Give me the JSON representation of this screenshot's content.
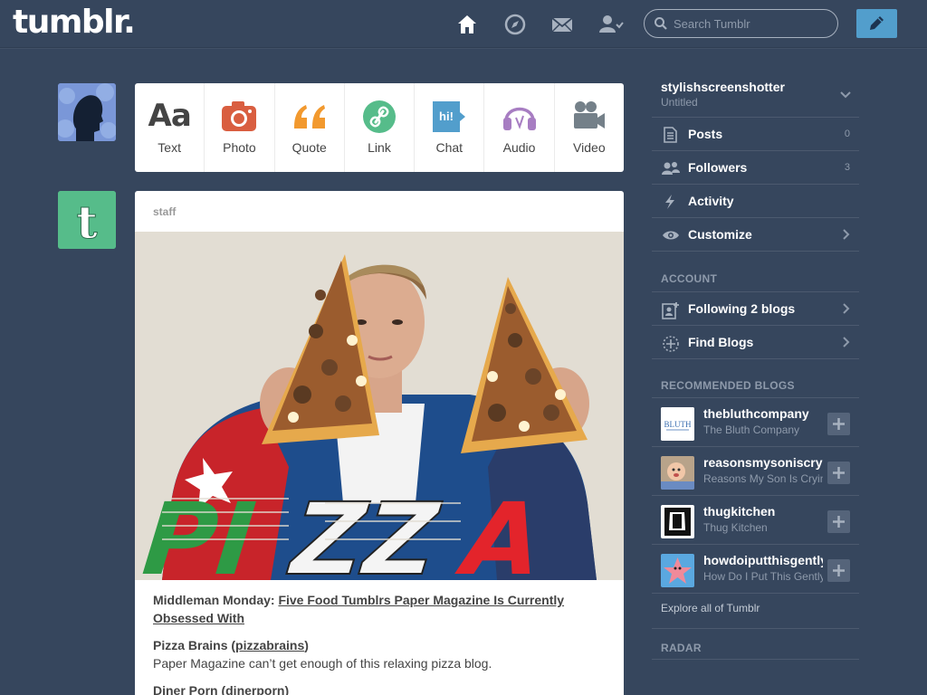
{
  "header": {
    "logo": "tumblr.",
    "search_placeholder": "Search Tumblr"
  },
  "post_types": [
    {
      "label": "Text",
      "icon": "text-icon",
      "color": "#444444"
    },
    {
      "label": "Photo",
      "icon": "camera-icon",
      "color": "#d95e40"
    },
    {
      "label": "Quote",
      "icon": "quote-icon",
      "color": "#f2992e"
    },
    {
      "label": "Link",
      "icon": "link-icon",
      "color": "#56bc8a"
    },
    {
      "label": "Chat",
      "icon": "chat-icon",
      "color": "#529ecc"
    },
    {
      "label": "Audio",
      "icon": "headphones-icon",
      "color": "#a77dc2"
    },
    {
      "label": "Video",
      "icon": "video-camera-icon",
      "color": "#748089"
    }
  ],
  "post": {
    "author": "staff",
    "image_text": "PIZZA",
    "heading_prefix": "Middleman Monday: ",
    "heading_link": "Five Food Tumblrs Paper Magazine Is Currently Obsessed With",
    "item1_title": "Pizza Brains (",
    "item1_link": "pizzabrains",
    "item1_close": ")",
    "item1_desc": "Paper Magazine can’t get enough of this relaxing pizza blog.",
    "item2_title": "Diner Porn (",
    "item2_link": "dinerporn",
    "item2_close": ")"
  },
  "sidebar": {
    "blog_name": "stylishscreenshotter",
    "blog_subtitle": "Untitled",
    "rows": [
      {
        "label": "Posts",
        "count": "0",
        "icon": "posts-icon"
      },
      {
        "label": "Followers",
        "count": "3",
        "icon": "followers-icon"
      },
      {
        "label": "Activity",
        "icon": "lightning-icon"
      },
      {
        "label": "Customize",
        "icon": "eye-icon"
      }
    ],
    "account_title": "ACCOUNT",
    "account_rows": [
      {
        "label": "Following 2 blogs",
        "icon": "following-icon"
      },
      {
        "label": "Find Blogs",
        "icon": "find-blogs-icon"
      }
    ],
    "recommended_title": "RECOMMENDED BLOGS",
    "recommended": [
      {
        "name": "thebluthcompany",
        "title": "The Bluth Company",
        "thumb_text": "BLUTH"
      },
      {
        "name": "reasonsmysoniscrying",
        "title": "Reasons My Son Is Crying"
      },
      {
        "name": "thugkitchen",
        "title": "Thug Kitchen"
      },
      {
        "name": "howdoiputthisgently",
        "title": "How Do I Put This Gently"
      }
    ],
    "explore": "Explore all of Tumblr",
    "radar_title": "RADAR"
  }
}
